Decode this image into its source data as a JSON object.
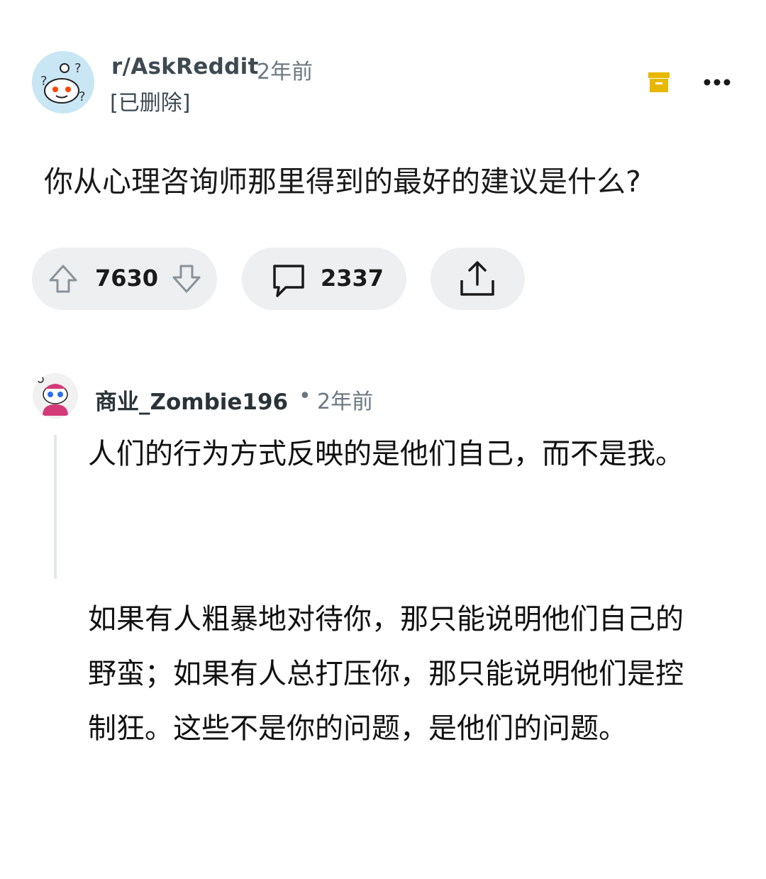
{
  "post": {
    "subreddit": "r/AskReddit",
    "time": "2年前",
    "author": "[已删除]",
    "title": "你从心理咨询师那里得到的最好的建议是什么?",
    "votes": "7630",
    "comments": "2337"
  },
  "icons": {
    "archive": "archive-icon",
    "more": "more-icon",
    "upvote": "upvote-arrow-icon",
    "downvote": "downvote-arrow-icon",
    "comment": "comment-bubble-icon",
    "share": "share-icon"
  },
  "colors": {
    "archive": "#e8b800",
    "pill_bg": "#edeff1",
    "thread_line": "#e4e6e8"
  },
  "comment": {
    "author": "商业_Zombie196",
    "separator": "•",
    "time": "2年前",
    "paragraphs": [
      "人们的行为方式反映的是他们自己，而不是我。",
      "如果有人粗暴地对待你，那只能说明他们自己的野蛮；如果有人总打压你，那只能说明他们是控制狂。这些不是你的问题，是他们的问题。"
    ]
  }
}
